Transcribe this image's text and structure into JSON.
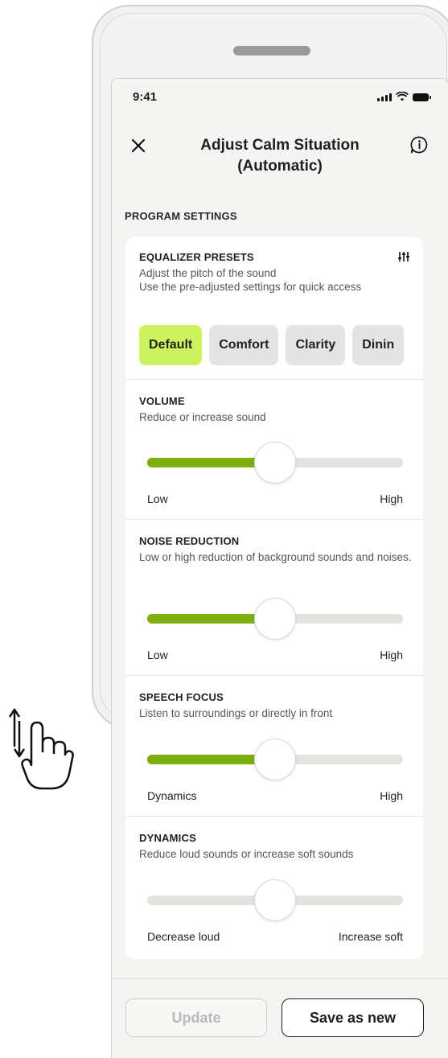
{
  "status_bar": {
    "time": "9:41"
  },
  "header": {
    "title_line1": "Adjust Calm Situation",
    "title_line2": "(Automatic)"
  },
  "section_label": "PROGRAM SETTINGS",
  "equalizer": {
    "title": "EQUALIZER PRESETS",
    "desc_line1": "Adjust the pitch of the sound",
    "desc_line2": "Use the pre-adjusted settings for quick access",
    "presets": [
      "Default",
      "Comfort",
      "Clarity",
      "Dinin"
    ],
    "selected": "Default"
  },
  "volume": {
    "title": "VOLUME",
    "desc": "Reduce or increase sound",
    "min_label": "Low",
    "max_label": "High",
    "value": 0.5
  },
  "noise_reduction": {
    "title": "NOISE REDUCTION",
    "desc": "Low or high reduction of background sounds and noises.",
    "min_label": "Low",
    "max_label": "High",
    "value": 0.5
  },
  "speech_focus": {
    "title": "SPEECH FOCUS",
    "desc": "Listen to surroundings or directly in front",
    "min_label": "Dynamics",
    "max_label": "High",
    "value": 0.5
  },
  "dynamics": {
    "title": "DYNAMICS",
    "desc": "Reduce loud sounds or increase soft sounds",
    "min_label": "Decrease loud",
    "max_label": "Increase soft",
    "value": 0.5
  },
  "buttons": {
    "update": "Update",
    "save_as_new": "Save as new"
  },
  "colors": {
    "accent_fill": "#7cae0c",
    "selected_preset": "#cdf25f",
    "background": "#f4f4f3"
  },
  "icons": {
    "close": "close-icon",
    "info": "info-icon",
    "equalizer": "sliders-icon",
    "gesture": "scroll-gesture-hand-icon"
  }
}
